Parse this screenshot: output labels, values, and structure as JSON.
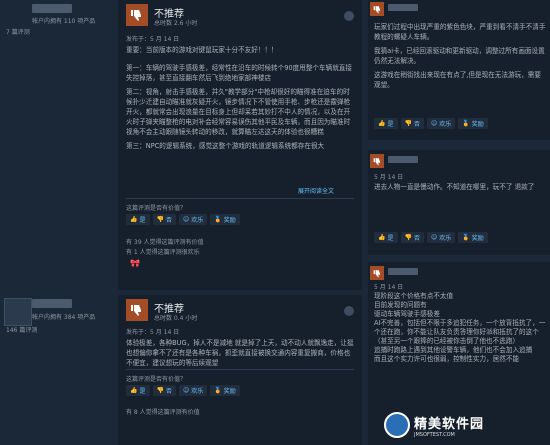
{
  "top_left_user": {
    "owned": "帐户内拥有 110 项产品",
    "reviews": "7 篇评测"
  },
  "review1": {
    "verdict": "不推荐",
    "hours": "总时数 2.6 小时",
    "date": "发布于：5 月 14 日",
    "paragraphs": [
      "重要：当前版本的游戏对键鼠玩家十分不友好！！！",
      "第一：车辆的驾驶手感极差，经常性在沿车的时候转个90度甩整个车辆就直接失控掉落，甚至直接翻车然后飞到绝地家部神楼店",
      "第二：视角，射击手感极差，并久\"教学部分\"中枪却很好的瞄得准在迫车的时候扑少迁建自动瞄准就灰疑开火，镜步情况下不管使用手枪、步枪还是霰弹枪开火，都就常会出现浪量在目标身上但却呆若其妙打不中人的情况，以及在开火时子弹夹瞄整枪的电对补会经常容易误伤其他平民及车辆，而且因为瞄准时视角不会主动跟随镜头转动的移改，就算瞄左达这天的体验也很糟糕",
      "第三：NPC的逻辑系统，感觉这整个游戏的轨道逻辑系统都存在很大"
    ],
    "read_more": "展开阅读全文",
    "helpful_q": "这篇评测是否有价值？",
    "btn_yes": "是",
    "btn_no": "否",
    "btn_funny": "欢乐",
    "btn_award": "奖励",
    "stat_helpful": "有 39 人觉得这篇评测有价值",
    "stat_funny": "有 1 人觉得这篇评测很欢乐"
  },
  "review2_user": {
    "owned": "帐户内拥有 384 项产品",
    "reviews": "146 篇评测"
  },
  "review2": {
    "verdict": "不推荐",
    "hours": "总时数 0.4 小时",
    "date": "发布于：5 月 14 日",
    "paragraphs": [
      "体验极差，各种BUG，掉人不是减地 就是掉了上天，动不动人就飘逸走，让挺也想偏你拿不了还有是各种车祸，抓歪就直接被换交通内容重复搬商，价格也不便宜，建议想玩的等后续观望"
    ],
    "helpful_q": "这篇评测是否有价值？",
    "btn_yes": "是",
    "btn_no": "否",
    "btn_funny": "欢乐",
    "btn_award": "奖励",
    "stat_helpful": "有 8 人觉得这篇评测有价值"
  },
  "right1": {
    "paragraphs": [
      "玩家们过程中出现严重的紫色色块，严重到看不清手不清手教程的螺疑人车辆。",
      "我猜ai卡，已经回滚驱动和更新驱动，调整过所有画面设置仍然无法解决。",
      "这游戏在稍街找出来现在有点了,但是现在无法游玩，需要观望。"
    ],
    "btn_yes": "是",
    "btn_no": "否",
    "btn_funny": "欢乐",
    "btn_award": "奖励"
  },
  "right2": {
    "date": "5 月 14 日",
    "paragraphs": [
      "进去人物一直是慢动作。不知道在哪里，玩不了 退款了"
    ],
    "btn_yes": "是",
    "btn_no": "否",
    "btn_funny": "欢乐",
    "btn_award": "奖励"
  },
  "right3": {
    "date": "5 月 14 日",
    "paragraphs": [
      "现阶段这个价格有点不太值",
      "目前发现的问题有",
      "驱动车辆驾驶手感极差",
      "AI不完善，包括但不限于多追犯任务，一个放背抵抗了，一个还在跑，你不能让队友负责答理你好派和抵抗了的这个（甚至另一个跟捧的已经被你击倒了他也不逃跑）",
      "追捕时跑路上遇到其他设警车辆，他们也不会加入追捕",
      "而且这个实力许可也很弱，控制性实力，居然不能"
    ]
  },
  "watermark": {
    "name": "精美软件园",
    "url": "JMSOFTEST.COM"
  }
}
